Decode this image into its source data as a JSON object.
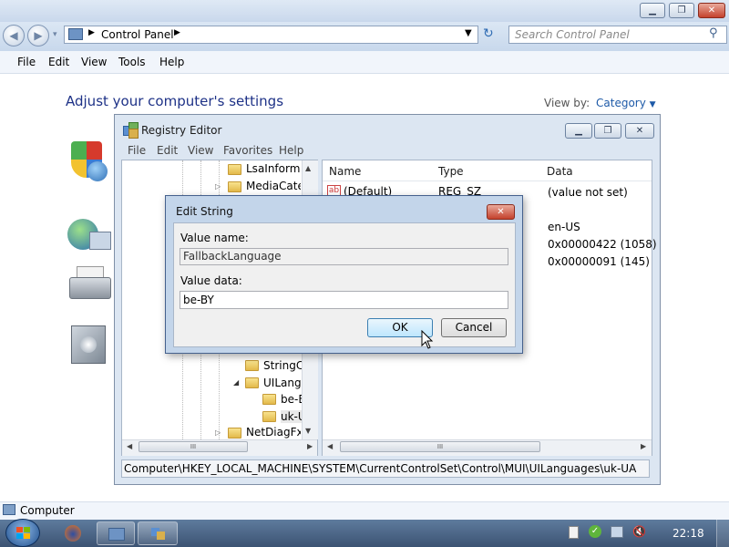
{
  "explorer": {
    "address_parts": [
      "Control Panel"
    ],
    "search_placeholder": "Search Control Panel",
    "menu": [
      "File",
      "Edit",
      "View",
      "Tools",
      "Help"
    ],
    "heading": "Adjust your computer's settings",
    "view_by_label": "View by:",
    "view_by_value": "Category",
    "status_text": "Computer"
  },
  "regedit": {
    "title": "Registry Editor",
    "menu": [
      "File",
      "Edit",
      "View",
      "Favorites",
      "Help"
    ],
    "tree_items": [
      "LsaInforma",
      "MediaCateg",
      "StringC",
      "UILangu",
      "be-E",
      "uk-U",
      "NetDiagFx"
    ],
    "columns": [
      "Name",
      "Type",
      "Data"
    ],
    "rows": [
      {
        "name": "(Default)",
        "type": "REG_SZ",
        "data": "(value not set)"
      },
      {
        "name": "",
        "type": "",
        "data": "en-US"
      },
      {
        "name": "",
        "type": "",
        "data": "0x00000422 (1058)"
      },
      {
        "name": "",
        "type": "",
        "data": "0x00000091 (145)"
      }
    ],
    "status_path": "Computer\\HKEY_LOCAL_MACHINE\\SYSTEM\\CurrentControlSet\\Control\\MUI\\UILanguages\\uk-UA"
  },
  "dialog": {
    "title": "Edit String",
    "value_name_label": "Value name:",
    "value_name": "FallbackLanguage",
    "value_data_label": "Value data:",
    "value_data": "be-BY",
    "ok_label": "OK",
    "cancel_label": "Cancel"
  },
  "taskbar": {
    "clock": "22:18"
  },
  "colors": {
    "heading": "#1e3287",
    "link": "#1e5aa8",
    "taskbar": "#4a6587"
  }
}
